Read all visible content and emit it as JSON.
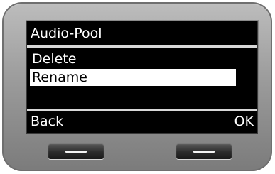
{
  "screen": {
    "title": "Audio-Pool",
    "menu": {
      "items": [
        {
          "label": "Delete",
          "selected": false
        },
        {
          "label": "Rename",
          "selected": true
        }
      ]
    },
    "softkeys": {
      "left_label": "Back",
      "right_label": "OK"
    }
  },
  "colors": {
    "screen_background": "#000000",
    "text": "#ffffff",
    "selection_background": "#ffffff",
    "selection_text": "#000000",
    "device_body": "#9c9c9c"
  }
}
